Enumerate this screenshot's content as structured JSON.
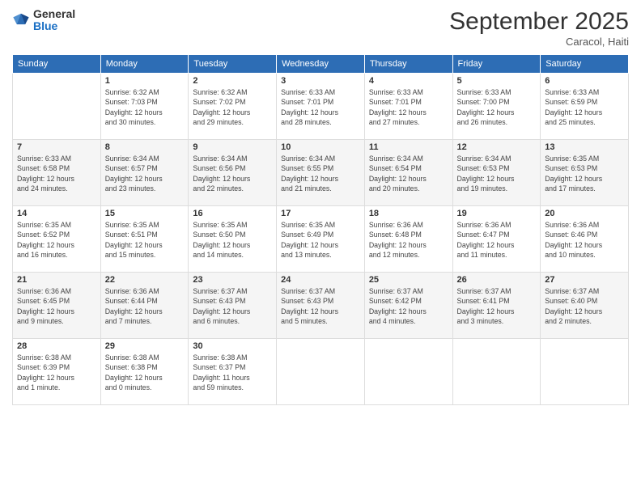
{
  "logo": {
    "general": "General",
    "blue": "Blue"
  },
  "title": "September 2025",
  "subtitle": "Caracol, Haiti",
  "days_of_week": [
    "Sunday",
    "Monday",
    "Tuesday",
    "Wednesday",
    "Thursday",
    "Friday",
    "Saturday"
  ],
  "weeks": [
    [
      {
        "day": "",
        "info": ""
      },
      {
        "day": "1",
        "info": "Sunrise: 6:32 AM\nSunset: 7:03 PM\nDaylight: 12 hours\nand 30 minutes."
      },
      {
        "day": "2",
        "info": "Sunrise: 6:32 AM\nSunset: 7:02 PM\nDaylight: 12 hours\nand 29 minutes."
      },
      {
        "day": "3",
        "info": "Sunrise: 6:33 AM\nSunset: 7:01 PM\nDaylight: 12 hours\nand 28 minutes."
      },
      {
        "day": "4",
        "info": "Sunrise: 6:33 AM\nSunset: 7:01 PM\nDaylight: 12 hours\nand 27 minutes."
      },
      {
        "day": "5",
        "info": "Sunrise: 6:33 AM\nSunset: 7:00 PM\nDaylight: 12 hours\nand 26 minutes."
      },
      {
        "day": "6",
        "info": "Sunrise: 6:33 AM\nSunset: 6:59 PM\nDaylight: 12 hours\nand 25 minutes."
      }
    ],
    [
      {
        "day": "7",
        "info": "Sunrise: 6:33 AM\nSunset: 6:58 PM\nDaylight: 12 hours\nand 24 minutes."
      },
      {
        "day": "8",
        "info": "Sunrise: 6:34 AM\nSunset: 6:57 PM\nDaylight: 12 hours\nand 23 minutes."
      },
      {
        "day": "9",
        "info": "Sunrise: 6:34 AM\nSunset: 6:56 PM\nDaylight: 12 hours\nand 22 minutes."
      },
      {
        "day": "10",
        "info": "Sunrise: 6:34 AM\nSunset: 6:55 PM\nDaylight: 12 hours\nand 21 minutes."
      },
      {
        "day": "11",
        "info": "Sunrise: 6:34 AM\nSunset: 6:54 PM\nDaylight: 12 hours\nand 20 minutes."
      },
      {
        "day": "12",
        "info": "Sunrise: 6:34 AM\nSunset: 6:53 PM\nDaylight: 12 hours\nand 19 minutes."
      },
      {
        "day": "13",
        "info": "Sunrise: 6:35 AM\nSunset: 6:53 PM\nDaylight: 12 hours\nand 17 minutes."
      }
    ],
    [
      {
        "day": "14",
        "info": "Sunrise: 6:35 AM\nSunset: 6:52 PM\nDaylight: 12 hours\nand 16 minutes."
      },
      {
        "day": "15",
        "info": "Sunrise: 6:35 AM\nSunset: 6:51 PM\nDaylight: 12 hours\nand 15 minutes."
      },
      {
        "day": "16",
        "info": "Sunrise: 6:35 AM\nSunset: 6:50 PM\nDaylight: 12 hours\nand 14 minutes."
      },
      {
        "day": "17",
        "info": "Sunrise: 6:35 AM\nSunset: 6:49 PM\nDaylight: 12 hours\nand 13 minutes."
      },
      {
        "day": "18",
        "info": "Sunrise: 6:36 AM\nSunset: 6:48 PM\nDaylight: 12 hours\nand 12 minutes."
      },
      {
        "day": "19",
        "info": "Sunrise: 6:36 AM\nSunset: 6:47 PM\nDaylight: 12 hours\nand 11 minutes."
      },
      {
        "day": "20",
        "info": "Sunrise: 6:36 AM\nSunset: 6:46 PM\nDaylight: 12 hours\nand 10 minutes."
      }
    ],
    [
      {
        "day": "21",
        "info": "Sunrise: 6:36 AM\nSunset: 6:45 PM\nDaylight: 12 hours\nand 9 minutes."
      },
      {
        "day": "22",
        "info": "Sunrise: 6:36 AM\nSunset: 6:44 PM\nDaylight: 12 hours\nand 7 minutes."
      },
      {
        "day": "23",
        "info": "Sunrise: 6:37 AM\nSunset: 6:43 PM\nDaylight: 12 hours\nand 6 minutes."
      },
      {
        "day": "24",
        "info": "Sunrise: 6:37 AM\nSunset: 6:43 PM\nDaylight: 12 hours\nand 5 minutes."
      },
      {
        "day": "25",
        "info": "Sunrise: 6:37 AM\nSunset: 6:42 PM\nDaylight: 12 hours\nand 4 minutes."
      },
      {
        "day": "26",
        "info": "Sunrise: 6:37 AM\nSunset: 6:41 PM\nDaylight: 12 hours\nand 3 minutes."
      },
      {
        "day": "27",
        "info": "Sunrise: 6:37 AM\nSunset: 6:40 PM\nDaylight: 12 hours\nand 2 minutes."
      }
    ],
    [
      {
        "day": "28",
        "info": "Sunrise: 6:38 AM\nSunset: 6:39 PM\nDaylight: 12 hours\nand 1 minute."
      },
      {
        "day": "29",
        "info": "Sunrise: 6:38 AM\nSunset: 6:38 PM\nDaylight: 12 hours\nand 0 minutes."
      },
      {
        "day": "30",
        "info": "Sunrise: 6:38 AM\nSunset: 6:37 PM\nDaylight: 11 hours\nand 59 minutes."
      },
      {
        "day": "",
        "info": ""
      },
      {
        "day": "",
        "info": ""
      },
      {
        "day": "",
        "info": ""
      },
      {
        "day": "",
        "info": ""
      }
    ]
  ]
}
